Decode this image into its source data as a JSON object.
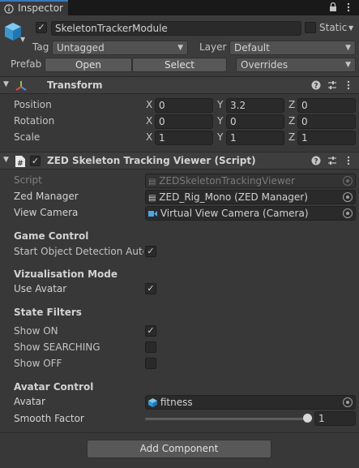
{
  "tab": {
    "label": "Inspector"
  },
  "header": {
    "object_name": "SkeletonTrackerModule",
    "active": true,
    "static_label": "Static",
    "tag_label": "Tag",
    "tag_value": "Untagged",
    "layer_label": "Layer",
    "layer_value": "Default",
    "prefab_label": "Prefab",
    "open_button": "Open",
    "select_button": "Select",
    "overrides_value": "Overrides"
  },
  "transform": {
    "title": "Transform",
    "rows": [
      {
        "label": "Position",
        "x": "0",
        "y": "3.2",
        "z": "0"
      },
      {
        "label": "Rotation",
        "x": "0",
        "y": "0",
        "z": "0"
      },
      {
        "label": "Scale",
        "x": "1",
        "y": "1",
        "z": "1"
      }
    ],
    "axis_x": "X",
    "axis_y": "Y",
    "axis_z": "Z"
  },
  "script_component": {
    "title": "ZED Skeleton Tracking Viewer (Script)",
    "enabled": true,
    "script_label": "Script",
    "script_value": "ZEDSkeletonTrackingViewer",
    "zed_manager_label": "Zed Manager",
    "zed_manager_value": "ZED_Rig_Mono (ZED Manager)",
    "view_camera_label": "View Camera",
    "view_camera_value": "Virtual View Camera (Camera)",
    "game_control_header": "Game Control",
    "start_detection_label": "Start Object Detection Autom",
    "start_detection_checked": true,
    "viz_mode_header": "Vizualisation Mode",
    "use_avatar_label": "Use Avatar",
    "use_avatar_checked": true,
    "state_filters_header": "State Filters",
    "show_on_label": "Show ON",
    "show_on_checked": true,
    "show_searching_label": "Show SEARCHING",
    "show_searching_checked": false,
    "show_off_label": "Show OFF",
    "show_off_checked": false,
    "avatar_control_header": "Avatar Control",
    "avatar_label": "Avatar",
    "avatar_value": "fitness",
    "smooth_factor_label": "Smooth Factor",
    "smooth_factor_value": "1",
    "smooth_factor_fraction": 1.0
  },
  "footer": {
    "add_component": "Add Component"
  },
  "icons": {
    "lock": "lock-icon",
    "menu": "kebab-menu-icon",
    "help": "help-icon",
    "presets": "sliders-icon",
    "check": "✓",
    "dropdown": "▼"
  },
  "colors": {
    "accent": "#3a79bb",
    "bg": "#383838",
    "field": "#2a2a2a"
  }
}
